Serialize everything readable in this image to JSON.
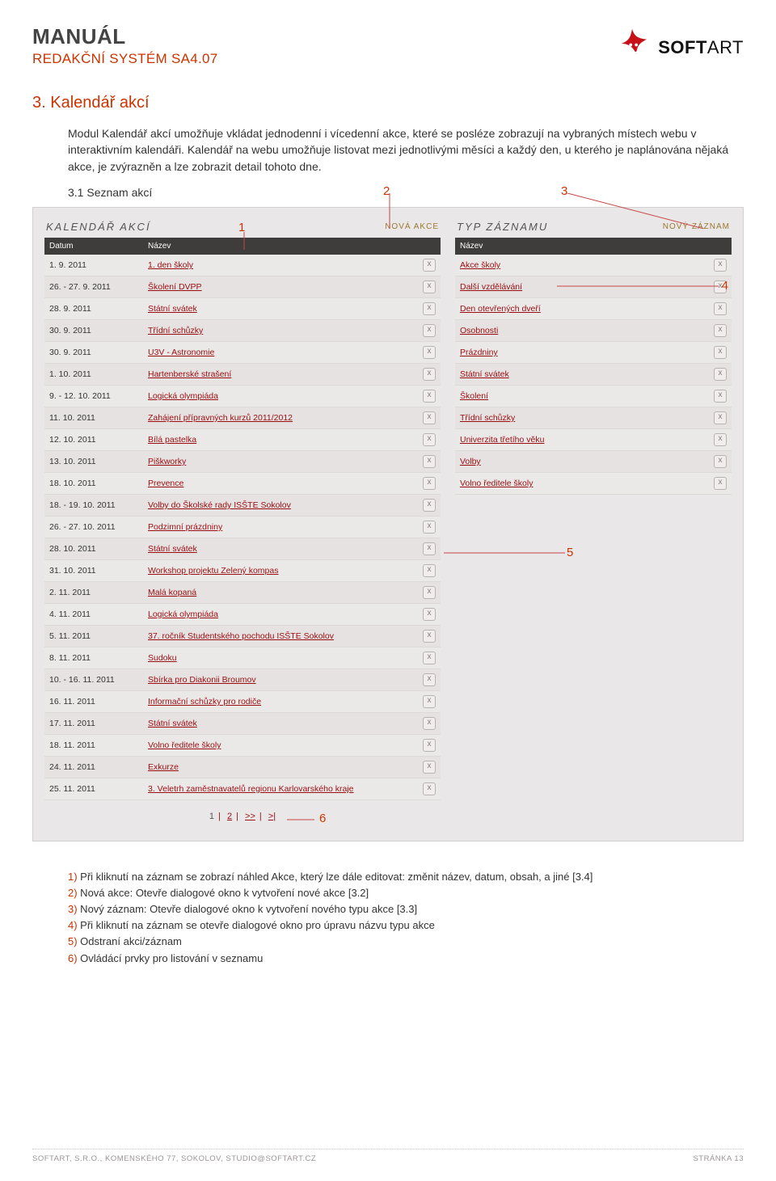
{
  "header": {
    "title": "MANUÁL",
    "subtitle": "REDAKČNÍ SYSTÉM SA4.07",
    "logo_soft": "SOFT",
    "logo_art": "ART"
  },
  "section": {
    "number_title": "3. Kalendář akcí",
    "para1": "Modul Kalendář akcí umožňuje vkládat jednodenní i vícedenní akce, které se posléze zobrazují na vybraných místech webu v interaktivním kalendáři. Kalendář na webu umožňuje listovat mezi jednotlivými měsíci a každý den, u kterého je naplánována nějaká akce, je zvýrazněn a lze zobrazit detail tohoto dne.",
    "sub_num": "3.1 Seznam akcí"
  },
  "callouts": {
    "c1": "1",
    "c2": "2",
    "c3": "3",
    "c4": "4",
    "c5": "5",
    "c6": "6"
  },
  "screenshot": {
    "left": {
      "title": "KALENDÁŘ AKCÍ",
      "action": "NOVÁ AKCE",
      "th_date": "Datum",
      "th_name": "Název",
      "rows": [
        {
          "date": "1. 9. 2011",
          "name": "1. den školy"
        },
        {
          "date": "26. - 27. 9. 2011",
          "name": "Školení DVPP"
        },
        {
          "date": "28. 9. 2011",
          "name": "Státní svátek"
        },
        {
          "date": "30. 9. 2011",
          "name": "Třídní schůzky"
        },
        {
          "date": "30. 9. 2011",
          "name": "U3V - Astronomie"
        },
        {
          "date": "1. 10. 2011",
          "name": "Hartenberské strašení"
        },
        {
          "date": "9. - 12. 10. 2011",
          "name": "Logická olympiáda"
        },
        {
          "date": "11. 10. 2011",
          "name": "Zahájení přípravných kurzů 2011/2012"
        },
        {
          "date": "12. 10. 2011",
          "name": "Bílá pastelka"
        },
        {
          "date": "13. 10. 2011",
          "name": "Piškworky"
        },
        {
          "date": "18. 10. 2011",
          "name": "Prevence"
        },
        {
          "date": "18. - 19. 10. 2011",
          "name": "Volby do Školské rady ISŠTE Sokolov"
        },
        {
          "date": "26. - 27. 10. 2011",
          "name": "Podzimní prázdniny"
        },
        {
          "date": "28. 10. 2011",
          "name": "Státní svátek"
        },
        {
          "date": "31. 10. 2011",
          "name": "Workshop projektu Zelený kompas"
        },
        {
          "date": "2. 11. 2011",
          "name": "Malá kopaná"
        },
        {
          "date": "4. 11. 2011",
          "name": "Logická olympiáda"
        },
        {
          "date": "5. 11. 2011",
          "name": "37. ročník Studentského pochodu ISŠTE Sokolov"
        },
        {
          "date": "8. 11. 2011",
          "name": "Sudoku"
        },
        {
          "date": "10. - 16. 11. 2011",
          "name": "Sbírka pro Diakonii Broumov"
        },
        {
          "date": "16. 11. 2011",
          "name": "Informační schůzky pro rodiče"
        },
        {
          "date": "17. 11. 2011",
          "name": "Státní svátek"
        },
        {
          "date": "18. 11. 2011",
          "name": "Volno ředitele školy"
        },
        {
          "date": "24. 11. 2011",
          "name": "Exkurze"
        },
        {
          "date": "25. 11. 2011",
          "name": "3. Veletrh zaměstnavatelů regionu Karlovarského kraje"
        }
      ],
      "pager": {
        "p1": "1",
        "p2": "2",
        "next": ">>",
        "last": ">|"
      }
    },
    "right": {
      "title": "TYP ZÁZNAMU",
      "action": "NOVÝ ZÁZNAM",
      "th_name": "Název",
      "rows": [
        {
          "name": "Akce školy"
        },
        {
          "name": "Další vzdělávání"
        },
        {
          "name": "Den otevřených dveří"
        },
        {
          "name": "Osobnosti"
        },
        {
          "name": "Prázdniny"
        },
        {
          "name": "Státní svátek"
        },
        {
          "name": "Školení"
        },
        {
          "name": "Třídní schůzky"
        },
        {
          "name": "Univerzita třetího věku"
        },
        {
          "name": "Volby"
        },
        {
          "name": "Volno ředitele školy"
        }
      ]
    }
  },
  "legend": {
    "i1n": "1)",
    "i1": " Při kliknutí na záznam se zobrazí náhled Akce, který lze dále editovat: změnit název, datum, obsah, a jiné [3.4]",
    "i2n": "2)",
    "i2": " Nová akce: Otevře dialogové okno k vytvoření nové akce [3.2]",
    "i3n": "3)",
    "i3": " Nový záznam: Otevře dialogové okno k vytvoření nového typu akce [3.3]",
    "i4n": "4)",
    "i4": " Při kliknutí na záznam se otevře dialogové okno pro úpravu názvu typu akce",
    "i5n": "5)",
    "i5": " Odstraní akci/záznam",
    "i6n": "6)",
    "i6": " Ovládácí prvky pro listování v seznamu"
  },
  "footer": {
    "left": "SOFTART, S.R.O., KOMENSKÉHO 77, SOKOLOV, STUDIO@SOFTART.CZ",
    "right": "STRÁNKA 13"
  }
}
